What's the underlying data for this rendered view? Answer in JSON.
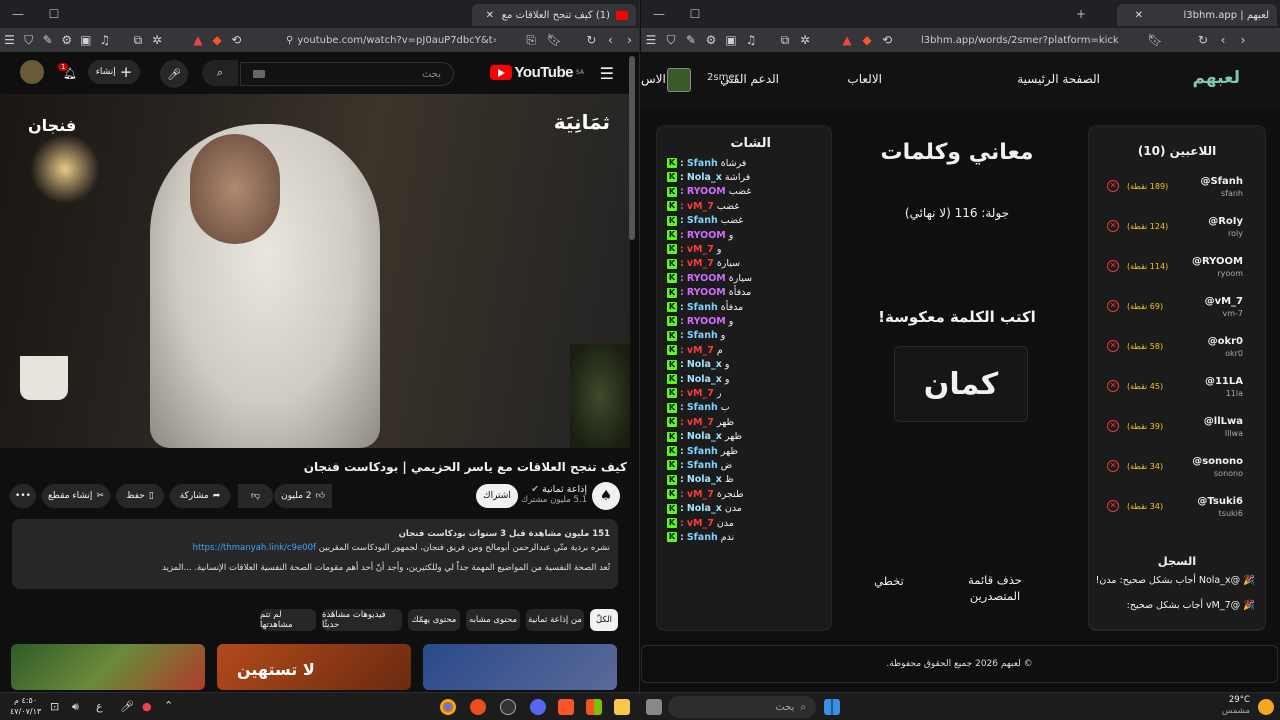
{
  "left_window": {
    "tab_title": "(1) كيف تنجح العلاقات مع ياسر ا",
    "url": "youtube.com/watch?v=pJ0auP7dbcY&t=8...",
    "youtube": {
      "logo_text": "YouTube",
      "region": "SA",
      "search_placeholder": "بحث",
      "create_label": "إنشاء",
      "notif_count": "1",
      "video_label_left": "فنجان",
      "video_label_right": "ثمَانِيَة",
      "title": "كيف تنجح العلاقات مع ياسر الحزيمي | بودكاست فنجان",
      "channel_name": "إذاعة ثمانية",
      "subscribers": "5.1 مليون مشترك",
      "subscribe_label": "اشتراك",
      "likes": "2 مليون",
      "share_label": "مشاركة",
      "save_label": "حفظ",
      "clip_label": "إنشاء مقطع",
      "desc_line1": "151 مليون مشاهدة  قبل 3 سنوات  بودكاست فنجان",
      "desc_line2": "نشره بردية متّي عبدالرحمن أبومالح ومن فريق فنجان، لجمهور البودكاست المقربين",
      "desc_link": "https://thmanyah.link/c9e00f",
      "desc_line3": "تُعد الصحة النفسية من المواضيع المهمة جداً لي وللكثيرين، وأجد أنّ أحد أهم مقومات الصحة النفسية العلاقات الإنسانية.  ...المزيد",
      "chips": [
        "الكلّ",
        "من إذاعة ثمانية",
        "محتوى مشابه",
        "محتوى يهمّك",
        "فيديوهات مشاهَدة حديثًا",
        "لم تتم مشاهدتها"
      ],
      "thumb_text": "لا تستهين"
    }
  },
  "right_window": {
    "tab_title": "لعبهم | l3bhm.app",
    "url": "l3bhm.app/words/2smer?platform=kick",
    "logo": "لعبهم",
    "nav": {
      "home": "الصفحة الرئيسية",
      "games": "الالعاب",
      "support": "الدعم الفني",
      "username": "2smer",
      "extra": "الاس"
    },
    "players_title": "اللاعبين (10)",
    "players": [
      {
        "name": "@Sfanh",
        "sub": "sfanh",
        "points": "(189 نقطة)"
      },
      {
        "name": "@RoIy",
        "sub": "roly",
        "points": "(124 نقطة)"
      },
      {
        "name": "@RYOOM",
        "sub": "ryoom",
        "points": "(114 نقطة)"
      },
      {
        "name": "@vM_7",
        "sub": "vm-7",
        "points": "(69 نقطة)"
      },
      {
        "name": "@okr0",
        "sub": "okr0",
        "points": "(58 نقطة)"
      },
      {
        "name": "@11LA",
        "sub": "11la",
        "points": "(45 نقطة)"
      },
      {
        "name": "@llLwa",
        "sub": "lllwa",
        "points": "(39 نقطة)"
      },
      {
        "name": "@sonono",
        "sub": "sonono",
        "points": "(34 نقطة)"
      },
      {
        "name": "@Tsuki6",
        "sub": "tsuki6",
        "points": "(34 نقطة)"
      }
    ],
    "game_title": "معاني وكلمات",
    "round": "جولة: 116 (لا نهائي)",
    "prompt": "اكتب الكلمة معكوسة!",
    "word": "كمان",
    "chat_title": "الشات",
    "chat": [
      {
        "user": "Sfanh",
        "msg": "فرشاة",
        "color": "#7fd4ff"
      },
      {
        "user": "Nola_x",
        "msg": "فراشة",
        "color": "#9fe3ff"
      },
      {
        "user": "RYOOM",
        "msg": "غضب",
        "color": "#d06bff"
      },
      {
        "user": "vM_7",
        "msg": "غضب",
        "color": "#ff3b3b"
      },
      {
        "user": "Sfanh",
        "msg": "غضب",
        "color": "#7fd4ff"
      },
      {
        "user": "RYOOM",
        "msg": "و",
        "color": "#d06bff"
      },
      {
        "user": "vM_7",
        "msg": "و",
        "color": "#ff3b3b"
      },
      {
        "user": "vM_7",
        "msg": "سيارة",
        "color": "#ff3b3b"
      },
      {
        "user": "RYOOM",
        "msg": "سيارة",
        "color": "#d06bff"
      },
      {
        "user": "RYOOM",
        "msg": "مدفأة",
        "color": "#d06bff"
      },
      {
        "user": "Sfanh",
        "msg": "مدفأة",
        "color": "#7fd4ff"
      },
      {
        "user": "RYOOM",
        "msg": "و",
        "color": "#d06bff"
      },
      {
        "user": "Sfanh",
        "msg": "و",
        "color": "#7fd4ff"
      },
      {
        "user": "vM_7",
        "msg": "م",
        "color": "#ff3b3b"
      },
      {
        "user": "Nola_x",
        "msg": "و",
        "color": "#9fe3ff"
      },
      {
        "user": "Nola_x",
        "msg": "و",
        "color": "#9fe3ff"
      },
      {
        "user": "vM_7",
        "msg": "ر",
        "color": "#ff3b3b"
      },
      {
        "user": "Sfanh",
        "msg": "ب",
        "color": "#7fd4ff"
      },
      {
        "user": "vM_7",
        "msg": "ظهر",
        "color": "#ff3b3b"
      },
      {
        "user": "Nola_x",
        "msg": "ظهر",
        "color": "#9fe3ff"
      },
      {
        "user": "Sfanh",
        "msg": "ظهر",
        "color": "#7fd4ff"
      },
      {
        "user": "Sfanh",
        "msg": "ض",
        "color": "#7fd4ff"
      },
      {
        "user": "Nola_x",
        "msg": "ظ",
        "color": "#9fe3ff"
      },
      {
        "user": "vM_7",
        "msg": "طنجرة",
        "color": "#ff3b3b"
      },
      {
        "user": "Nola_x",
        "msg": "مدن",
        "color": "#9fe3ff"
      },
      {
        "user": "vM_7",
        "msg": "مدن",
        "color": "#ff3b3b"
      },
      {
        "user": "Sfanh",
        "msg": "ندم",
        "color": "#7fd4ff"
      }
    ],
    "skip_label": "تخطي",
    "clear_label": "حذف قائمة المتصدرين",
    "log_title": "السجل",
    "log": [
      "🎉 @Nola_x أجاب بشكل صحيح: مدن!",
      "🎉 @vM_7 أجاب بشكل صحيح:"
    ],
    "footer": "© لعبهم 2026 جميع الحقوق محفوظة."
  },
  "taskbar": {
    "search_placeholder": "بحث",
    "weather_temp": "29°C",
    "weather_desc": "مشمس",
    "time": "٤:٥٠ م",
    "date": "٤٧/٠٧/١٣",
    "lang": "ع"
  }
}
